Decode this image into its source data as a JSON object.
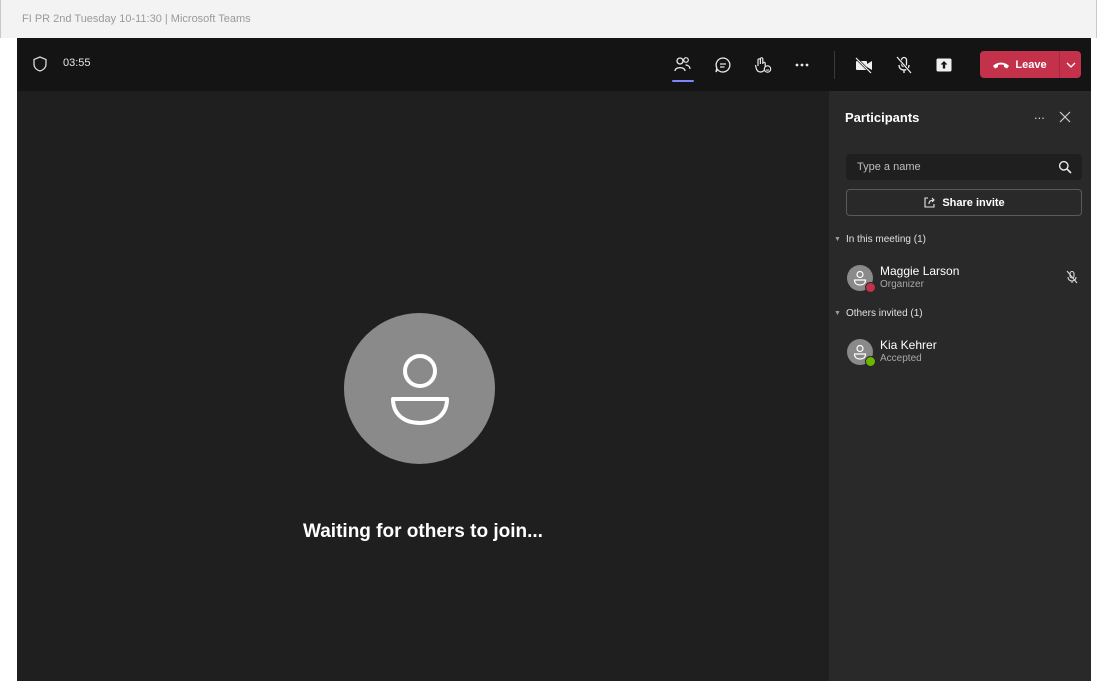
{
  "window": {
    "title": "FI PR 2nd Tuesday 10-11:30 | Microsoft Teams"
  },
  "toolbar": {
    "timer": "03:55",
    "buttons": [
      "people-icon",
      "chat-icon",
      "reactions-icon",
      "more-icon",
      "camera-off-icon",
      "mic-off-icon",
      "share-screen-icon"
    ],
    "leave_label": "Leave",
    "leave_color": "#c4314b",
    "active_color": "#7f85f5"
  },
  "stage": {
    "waiting_text": "Waiting for others to join..."
  },
  "participants": {
    "title": "Participants",
    "more": "...",
    "search_placeholder": "Type a name",
    "share_label": "Share invite",
    "sections": [
      {
        "label": "In this meeting (1)",
        "people": [
          {
            "name": "Maggie Larson",
            "role": "Organizer",
            "status_color": "#c4314b",
            "muted": true
          }
        ]
      },
      {
        "label": "Others invited (1)",
        "people": [
          {
            "name": "Kia Kehrer",
            "role": "Accepted",
            "status_color": "#6bb700",
            "muted": false
          }
        ]
      }
    ]
  }
}
